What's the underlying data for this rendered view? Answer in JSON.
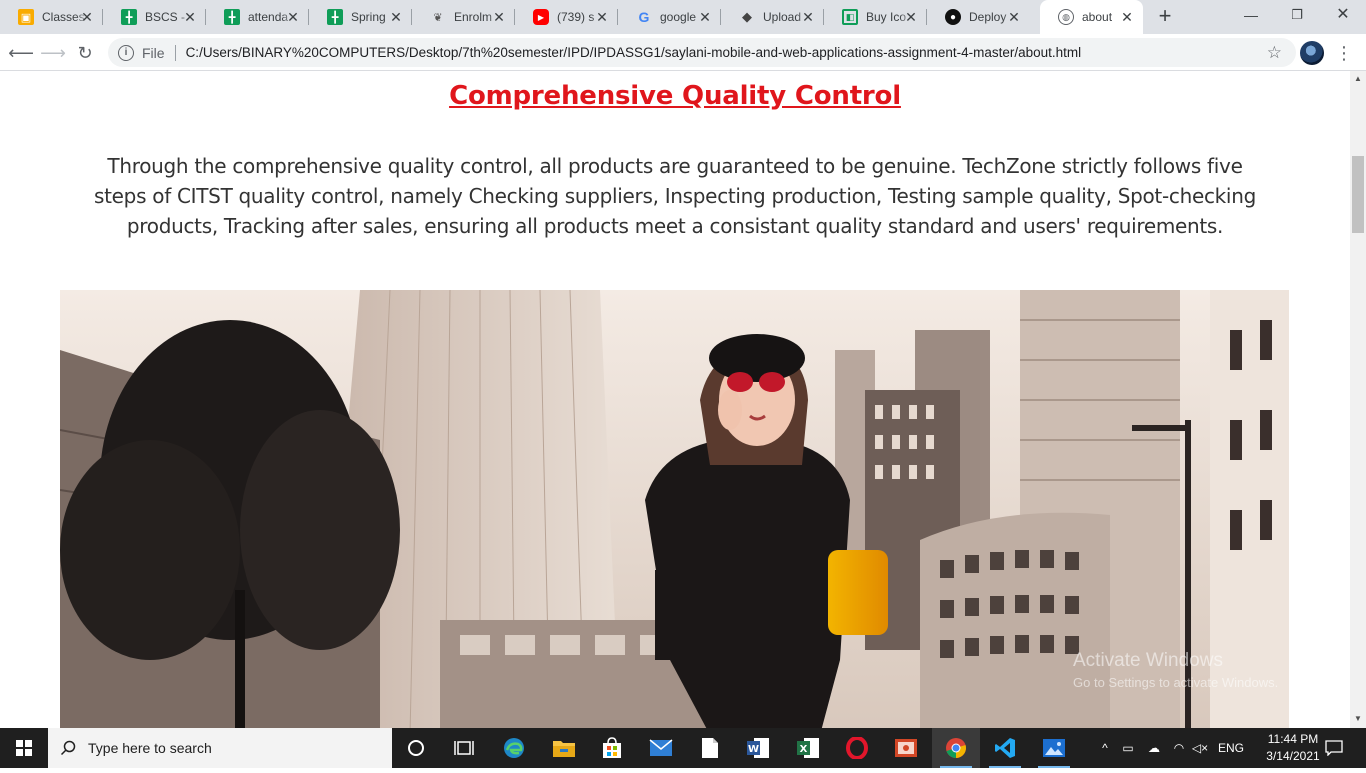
{
  "browser": {
    "tabs": [
      {
        "title": "Classes",
        "icon": "google-classroom-icon",
        "color": "#f9ab00"
      },
      {
        "title": "BSCS -",
        "icon": "google-sheets-icon",
        "color": "#0f9d58"
      },
      {
        "title": "attenda",
        "icon": "google-sheets-icon",
        "color": "#0f9d58"
      },
      {
        "title": "Spring",
        "icon": "google-sheets-icon",
        "color": "#0f9d58"
      },
      {
        "title": "Enrolm",
        "icon": "university-logo-icon",
        "color": "#555555"
      },
      {
        "title": "(739) s",
        "icon": "youtube-icon",
        "color": "#ff0000"
      },
      {
        "title": "google",
        "icon": "google-icon",
        "color": "#4285f4"
      },
      {
        "title": "Upload",
        "icon": "graduation-cap-icon",
        "color": "#444444"
      },
      {
        "title": "Buy Ico",
        "icon": "green-square-icon",
        "color": "#0f9d58"
      },
      {
        "title": "Deploy",
        "icon": "github-icon",
        "color": "#111111"
      },
      {
        "title": "about",
        "icon": "globe-icon",
        "color": "#5f6368"
      }
    ],
    "active_tab": 10,
    "address": {
      "scheme_label": "File",
      "url": "C:/Users/BINARY%20COMPUTERS/Desktop/7th%20semester/IPD/IPDASSG1/saylani-mobile-and-web-applications-assignment-4-master/about.html"
    }
  },
  "page": {
    "heading": "Comprehensive Quality Control",
    "paragraph": "Through the comprehensive quality control, all products are guaranteed to be genuine. TechZone strictly follows five steps of CITST quality control, namely Checking suppliers, Inspecting production, Testing sample quality, Spot-checking products, Tracking after sales, ensuring all products meet a consistant quality standard and users' requirements.",
    "heading_color": "#e0161c"
  },
  "watermark": {
    "line1": "Activate Windows",
    "line2": "Go to Settings to activate Windows."
  },
  "taskbar": {
    "search_placeholder": "Type here to search",
    "language": "ENG",
    "time": "11:44 PM",
    "date": "3/14/2021"
  }
}
